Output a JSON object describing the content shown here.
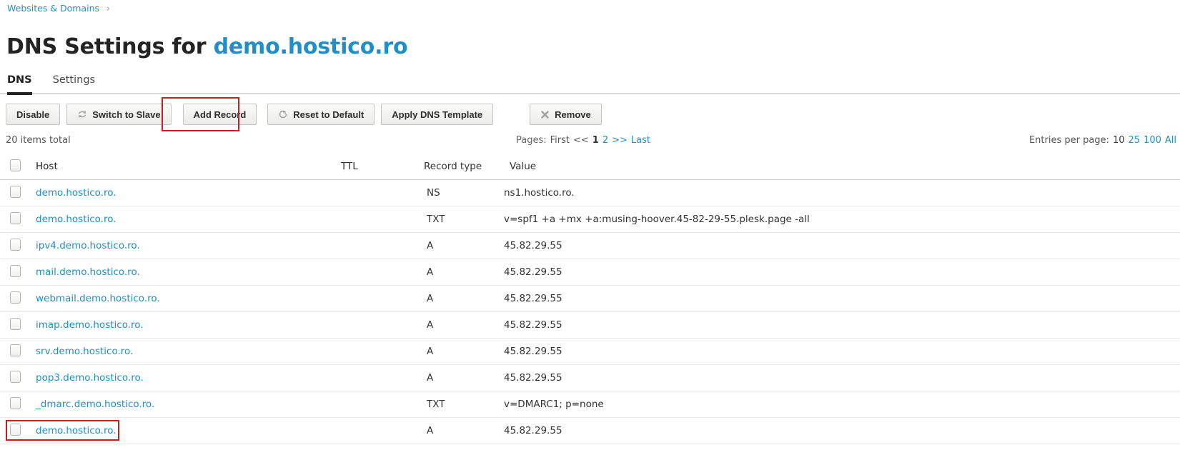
{
  "colors": {
    "link_blue": "#1f8fc9",
    "annotation_red": "#c32121"
  },
  "breadcrumb": {
    "label": "Websites & Domains",
    "separator": "›"
  },
  "title": {
    "prefix": "DNS Settings for ",
    "domain": "demo.hostico.ro"
  },
  "tabs": [
    {
      "label": "DNS"
    },
    {
      "label": "Settings"
    }
  ],
  "toolbar": {
    "buttons": [
      {
        "label": "Disable",
        "icon": ""
      },
      {
        "label": "Switch to Slave",
        "icon": "switch-icon"
      },
      {
        "label": "Add Record",
        "icon": ""
      },
      {
        "label": "Reset to Default",
        "icon": "reset-icon"
      },
      {
        "label": "Apply DNS Template",
        "icon": ""
      },
      {
        "label": "Remove",
        "icon": "remove-icon"
      }
    ]
  },
  "list": {
    "items_total": "20 items total",
    "pagination": {
      "label": "Pages:",
      "first": "First",
      "prev": "<<",
      "current": "1",
      "page2": "2",
      "next": ">>",
      "last": "Last"
    },
    "entries": {
      "label": "Entries per page:",
      "current": "10",
      "opt25": "25",
      "opt100": "100",
      "optall": "All"
    }
  },
  "table": {
    "headers": {
      "host": "Host",
      "ttl": "TTL",
      "type": "Record type",
      "value": "Value"
    },
    "rows": [
      {
        "host": "demo.hostico.ro.",
        "ttl": "",
        "type": "NS",
        "value": "ns1.hostico.ro."
      },
      {
        "host": "demo.hostico.ro.",
        "ttl": "",
        "type": "TXT",
        "value": "v=spf1 +a +mx +a:musing-hoover.45-82-29-55.plesk.page -all"
      },
      {
        "host": "ipv4.demo.hostico.ro.",
        "ttl": "",
        "type": "A",
        "value": "45.82.29.55"
      },
      {
        "host": "mail.demo.hostico.ro.",
        "ttl": "",
        "type": "A",
        "value": "45.82.29.55"
      },
      {
        "host": "webmail.demo.hostico.ro.",
        "ttl": "",
        "type": "A",
        "value": "45.82.29.55"
      },
      {
        "host": "imap.demo.hostico.ro.",
        "ttl": "",
        "type": "A",
        "value": "45.82.29.55"
      },
      {
        "host": "srv.demo.hostico.ro.",
        "ttl": "",
        "type": "A",
        "value": "45.82.29.55"
      },
      {
        "host": "pop3.demo.hostico.ro.",
        "ttl": "",
        "type": "A",
        "value": "45.82.29.55"
      },
      {
        "host": "_dmarc.demo.hostico.ro.",
        "ttl": "",
        "type": "TXT",
        "value": "v=DMARC1; p=none"
      },
      {
        "host": "demo.hostico.ro.",
        "ttl": "",
        "type": "A",
        "value": "45.82.29.55"
      }
    ]
  }
}
